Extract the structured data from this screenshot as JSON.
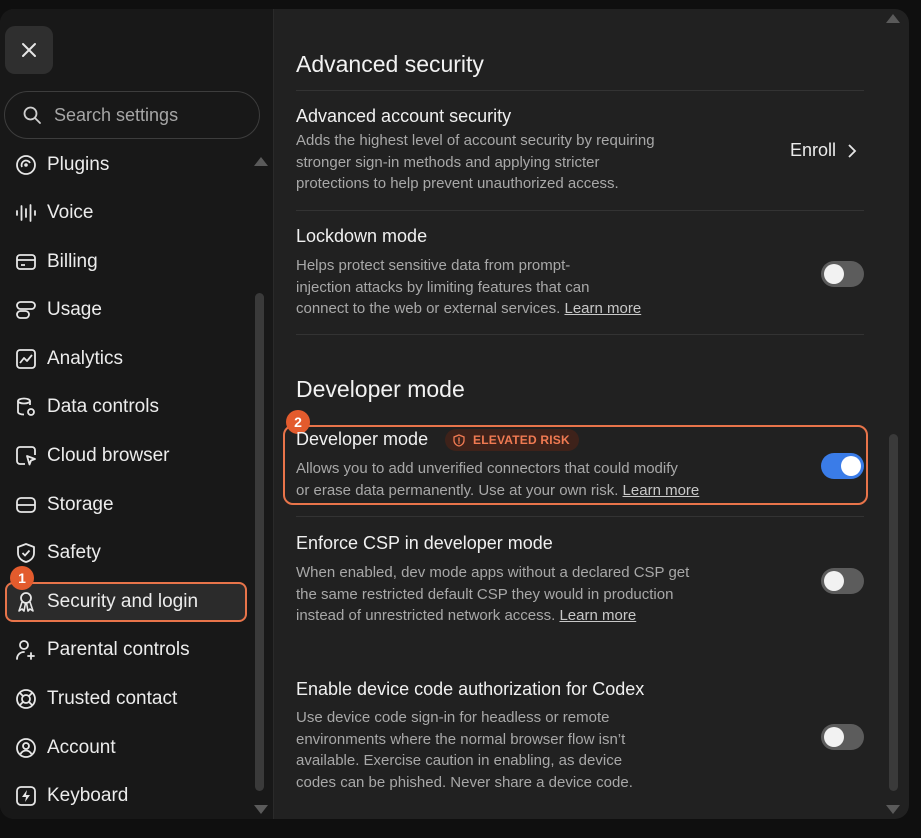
{
  "sidebar": {
    "search_placeholder": "Search settings",
    "items": [
      {
        "label": "Plugins",
        "icon": "plugins-icon"
      },
      {
        "label": "Voice",
        "icon": "voice-icon"
      },
      {
        "label": "Billing",
        "icon": "billing-icon"
      },
      {
        "label": "Usage",
        "icon": "usage-icon"
      },
      {
        "label": "Analytics",
        "icon": "analytics-icon"
      },
      {
        "label": "Data controls",
        "icon": "data-controls-icon"
      },
      {
        "label": "Cloud browser",
        "icon": "cloud-browser-icon"
      },
      {
        "label": "Storage",
        "icon": "storage-icon"
      },
      {
        "label": "Safety",
        "icon": "shield-icon"
      },
      {
        "label": "Security and login",
        "icon": "security-icon",
        "active": true
      },
      {
        "label": "Parental controls",
        "icon": "parental-controls-icon"
      },
      {
        "label": "Trusted contact",
        "icon": "lifebuoy-icon"
      },
      {
        "label": "Account",
        "icon": "account-icon"
      },
      {
        "label": "Keyboard",
        "icon": "keyboard-icon"
      }
    ],
    "step_badge": "1"
  },
  "main": {
    "advanced_security": {
      "title": "Advanced security",
      "account": {
        "title": "Advanced account security",
        "desc_lines": [
          "Adds the highest level of account security by requiring",
          "stronger sign-in methods and applying stricter",
          "protections to help prevent unauthorized access."
        ],
        "action_label": "Enroll"
      },
      "lockdown": {
        "title": "Lockdown mode",
        "desc_lines": [
          "Helps protect sensitive data from prompt-",
          "injection attacks by limiting features that can",
          "connect to the web or external services."
        ],
        "learn_more": "Learn more",
        "enabled": false
      }
    },
    "developer": {
      "title": "Developer mode",
      "step_badge": "2",
      "dev_mode": {
        "title": "Developer mode",
        "risk_label": "ELEVATED RISK",
        "desc_lines": [
          "Allows you to add unverified connectors that could modify",
          "or erase data permanently. Use at your own risk."
        ],
        "learn_more": "Learn more",
        "enabled": true
      },
      "csp": {
        "title": "Enforce CSP in developer mode",
        "desc_lines": [
          "When enabled, dev mode apps without a declared CSP get",
          "the same restricted default CSP they would in production",
          "instead of unrestricted network access."
        ],
        "learn_more": "Learn more",
        "enabled": false
      },
      "device_code": {
        "title": "Enable device code authorization for Codex",
        "desc_lines": [
          "Use device code sign-in for headless or remote",
          "environments where the normal browser flow isn’t",
          "available. Exercise caution in enabling, as device",
          "codes can be phished. Never share a device code."
        ],
        "enabled": false
      }
    }
  },
  "colors": {
    "accent_orange": "#e8744a",
    "toggle_on": "#3a7ce8",
    "badge": "#e35b2d"
  }
}
